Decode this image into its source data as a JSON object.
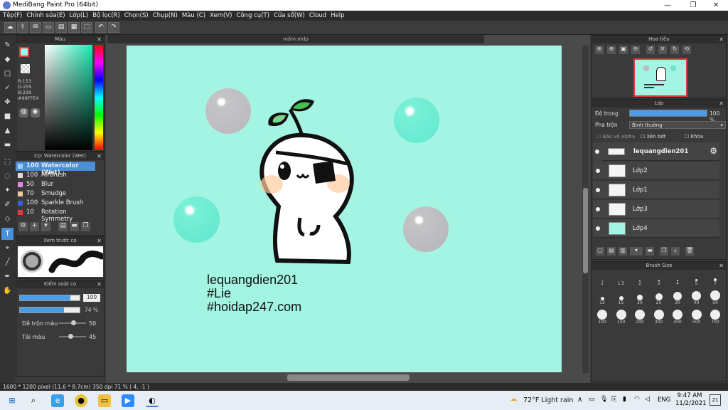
{
  "window": {
    "title": "MediBang Paint Pro (64bit)"
  },
  "menu": [
    "Tệp(F)",
    "Chỉnh sửa(E)",
    "Lớp(L)",
    "Bộ lọc(R)",
    "Chọn(S)",
    "Chụp(N)",
    "Màu (C)",
    "Xem(V)",
    "Công cụ(T)",
    "Cửa sổ(W)",
    "Cloud",
    "Help"
  ],
  "panels": {
    "color_title": "Màu",
    "color_values": {
      "r": "R:153",
      "g": "G:255",
      "b": "B:228",
      "hex": "#99FFE4"
    },
    "brush_title": "Cọ: Watercolor (Wet)",
    "brushes": [
      {
        "size": "100",
        "name": "Watercolor (Wet)",
        "color": "#4a9ee8"
      },
      {
        "size": "100",
        "name": "Airbrush",
        "color": "#dddddd"
      },
      {
        "size": "50",
        "name": "Blur",
        "color": "#e08ae0"
      },
      {
        "size": "70",
        "name": "Smudge",
        "color": "#f0c8a0"
      },
      {
        "size": "100",
        "name": "Sparkle Brush",
        "color": "#3a5ee0"
      },
      {
        "size": "10",
        "name": "Rotation Symmetry",
        "color": "#e03a3a"
      }
    ],
    "preview_title": "Xem trước cọ",
    "control_title": "Kiểm soát cọ",
    "control": {
      "size_value": "100",
      "opacity_value": "74 %",
      "blend_label": "Dễ trộn màu",
      "blend_value": "50",
      "resample_label": "Tải màu",
      "resample_value": "45"
    },
    "navigator_title": "Hoa tiêu",
    "layer_title": "Lớp",
    "opacity_label": "Độ trong",
    "opacity_value": "100 %",
    "blend_mode_label": "Pha trộn",
    "blend_mode_value": "Bình thường",
    "checks": [
      "Bảo vệ alpha",
      "Xén bớt",
      "Khóa"
    ],
    "layers": [
      "lequangdien201",
      "Lớp2",
      "Lớp1",
      "Lớp3",
      "Lớp4"
    ],
    "brush_size_title": "Brush Size",
    "brush_sizes": [
      "1",
      "1.5",
      "2",
      "3",
      "4",
      "5",
      "7",
      "12",
      "15",
      "20",
      "25",
      "30",
      "40",
      "50",
      "100",
      "150",
      "200",
      "300",
      "400",
      "500",
      "700"
    ]
  },
  "document": {
    "tab": "mầm.mdp",
    "caption_lines": [
      "lequangdien201",
      "#Lie",
      "#hoidap247.com"
    ]
  },
  "status": "1600 * 1200 pixel    (11.6 * 8.7cm)    350 dpi    71 %    ( 4, -1 )",
  "taskbar": {
    "weather": "72°F  Light rain",
    "lang": "ENG",
    "time": "9:47 AM",
    "date": "11/2/2021",
    "notif": "21"
  }
}
